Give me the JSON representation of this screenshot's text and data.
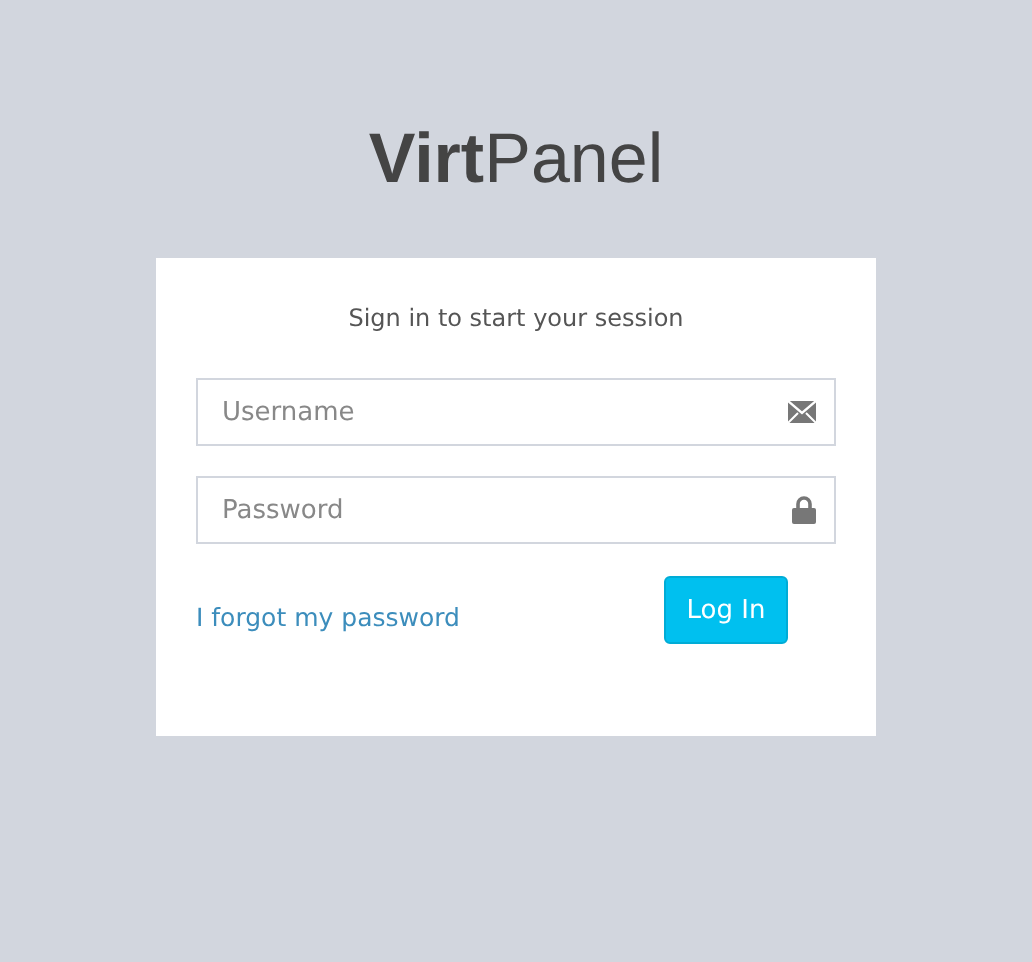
{
  "logo": "**Virt**Panel",
  "message": "Sign in to start your session",
  "fields": [
    {
      "placeholder": "Username",
      "kind": "email"
    },
    {
      "placeholder": "Password",
      "kind": "password"
    }
  ],
  "forgot_link": "I forgot my password",
  "button": "Log In"
}
